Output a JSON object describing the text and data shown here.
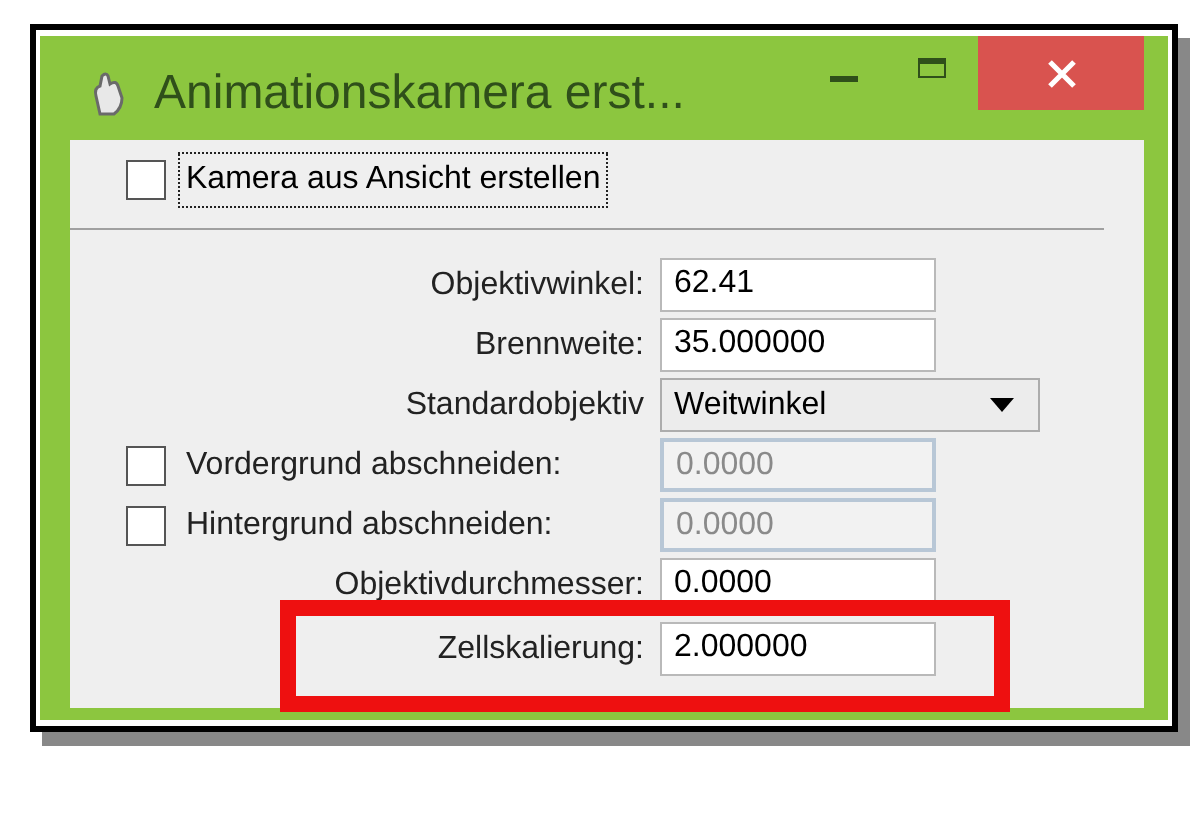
{
  "window": {
    "title": "Animationskamera erst...",
    "controls": [
      {
        "kind": "minimize"
      },
      {
        "kind": "maximize"
      },
      {
        "kind": "close"
      }
    ]
  },
  "top_option": {
    "label": "Kamera aus Ansicht erstellen",
    "checked": false,
    "focused": true
  },
  "fields": [
    {
      "kind": "text",
      "label": "Objektivwinkel:",
      "value": "62.41",
      "disabled": false,
      "highlighted": false
    },
    {
      "kind": "text",
      "label": "Brennweite:",
      "value": "35.000000",
      "disabled": false,
      "highlighted": false
    },
    {
      "kind": "dropdown",
      "label": "Standardobjektiv",
      "value": "Weitwinkel",
      "disabled": false,
      "highlighted": false
    },
    {
      "kind": "checkbox_text",
      "label": "Vordergrund abschneiden:",
      "checked": false,
      "value": "0.0000",
      "disabled": true,
      "highlighted": false
    },
    {
      "kind": "checkbox_text",
      "label": "Hintergrund abschneiden:",
      "checked": false,
      "value": "0.0000",
      "disabled": true,
      "highlighted": false
    },
    {
      "kind": "text",
      "label": "Objektivdurchmesser:",
      "value": "0.0000",
      "disabled": false,
      "highlighted": false
    },
    {
      "kind": "text",
      "label": "Zellskalierung:",
      "value": "2.000000",
      "disabled": false,
      "highlighted": true
    }
  ]
}
